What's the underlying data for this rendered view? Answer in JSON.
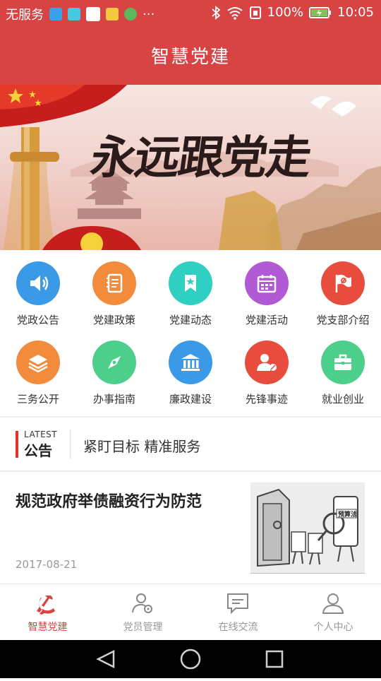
{
  "status": {
    "carrier": "无服务",
    "more": "···",
    "battery": "100%",
    "time": "10:05"
  },
  "header": {
    "title": "智慧党建"
  },
  "banner": {
    "slogan": "永远跟党走"
  },
  "grid": {
    "items": [
      {
        "label": "党政公告",
        "icon": "speaker-icon",
        "color": "#3a9ae8"
      },
      {
        "label": "党建政策",
        "icon": "notebook-icon",
        "color": "#f28b3c"
      },
      {
        "label": "党建动态",
        "icon": "bookmark-star-icon",
        "color": "#2fcfc2"
      },
      {
        "label": "党建活动",
        "icon": "calendar-icon",
        "color": "#b25ad6"
      },
      {
        "label": "党支部介绍",
        "icon": "party-flag-icon",
        "color": "#e84c3d"
      },
      {
        "label": "三务公开",
        "icon": "layers-icon",
        "color": "#f28b3c"
      },
      {
        "label": "办事指南",
        "icon": "compass-icon",
        "color": "#4ccf8a"
      },
      {
        "label": "廉政建设",
        "icon": "institution-icon",
        "color": "#3a9ae8"
      },
      {
        "label": "先锋事迹",
        "icon": "pioneer-icon",
        "color": "#e84c3d"
      },
      {
        "label": "就业创业",
        "icon": "briefcase-icon",
        "color": "#4ccf8a"
      }
    ]
  },
  "notice": {
    "badge_top": "LATEST",
    "badge_bottom": "公告",
    "text": "紧盯目标  精准服务"
  },
  "news": {
    "title": "规范政府举债融资行为防范",
    "date": "2017-08-21",
    "thumb_tag": "预算法"
  },
  "tabs": [
    {
      "label": "智慧党建",
      "icon": "party-emblem-icon",
      "active": true
    },
    {
      "label": "党员管理",
      "icon": "member-settings-icon",
      "active": false
    },
    {
      "label": "在线交流",
      "icon": "chat-icon",
      "active": false
    },
    {
      "label": "个人中心",
      "icon": "user-icon",
      "active": false
    }
  ],
  "colors": {
    "brand": "#d84444",
    "muted": "#999999"
  }
}
